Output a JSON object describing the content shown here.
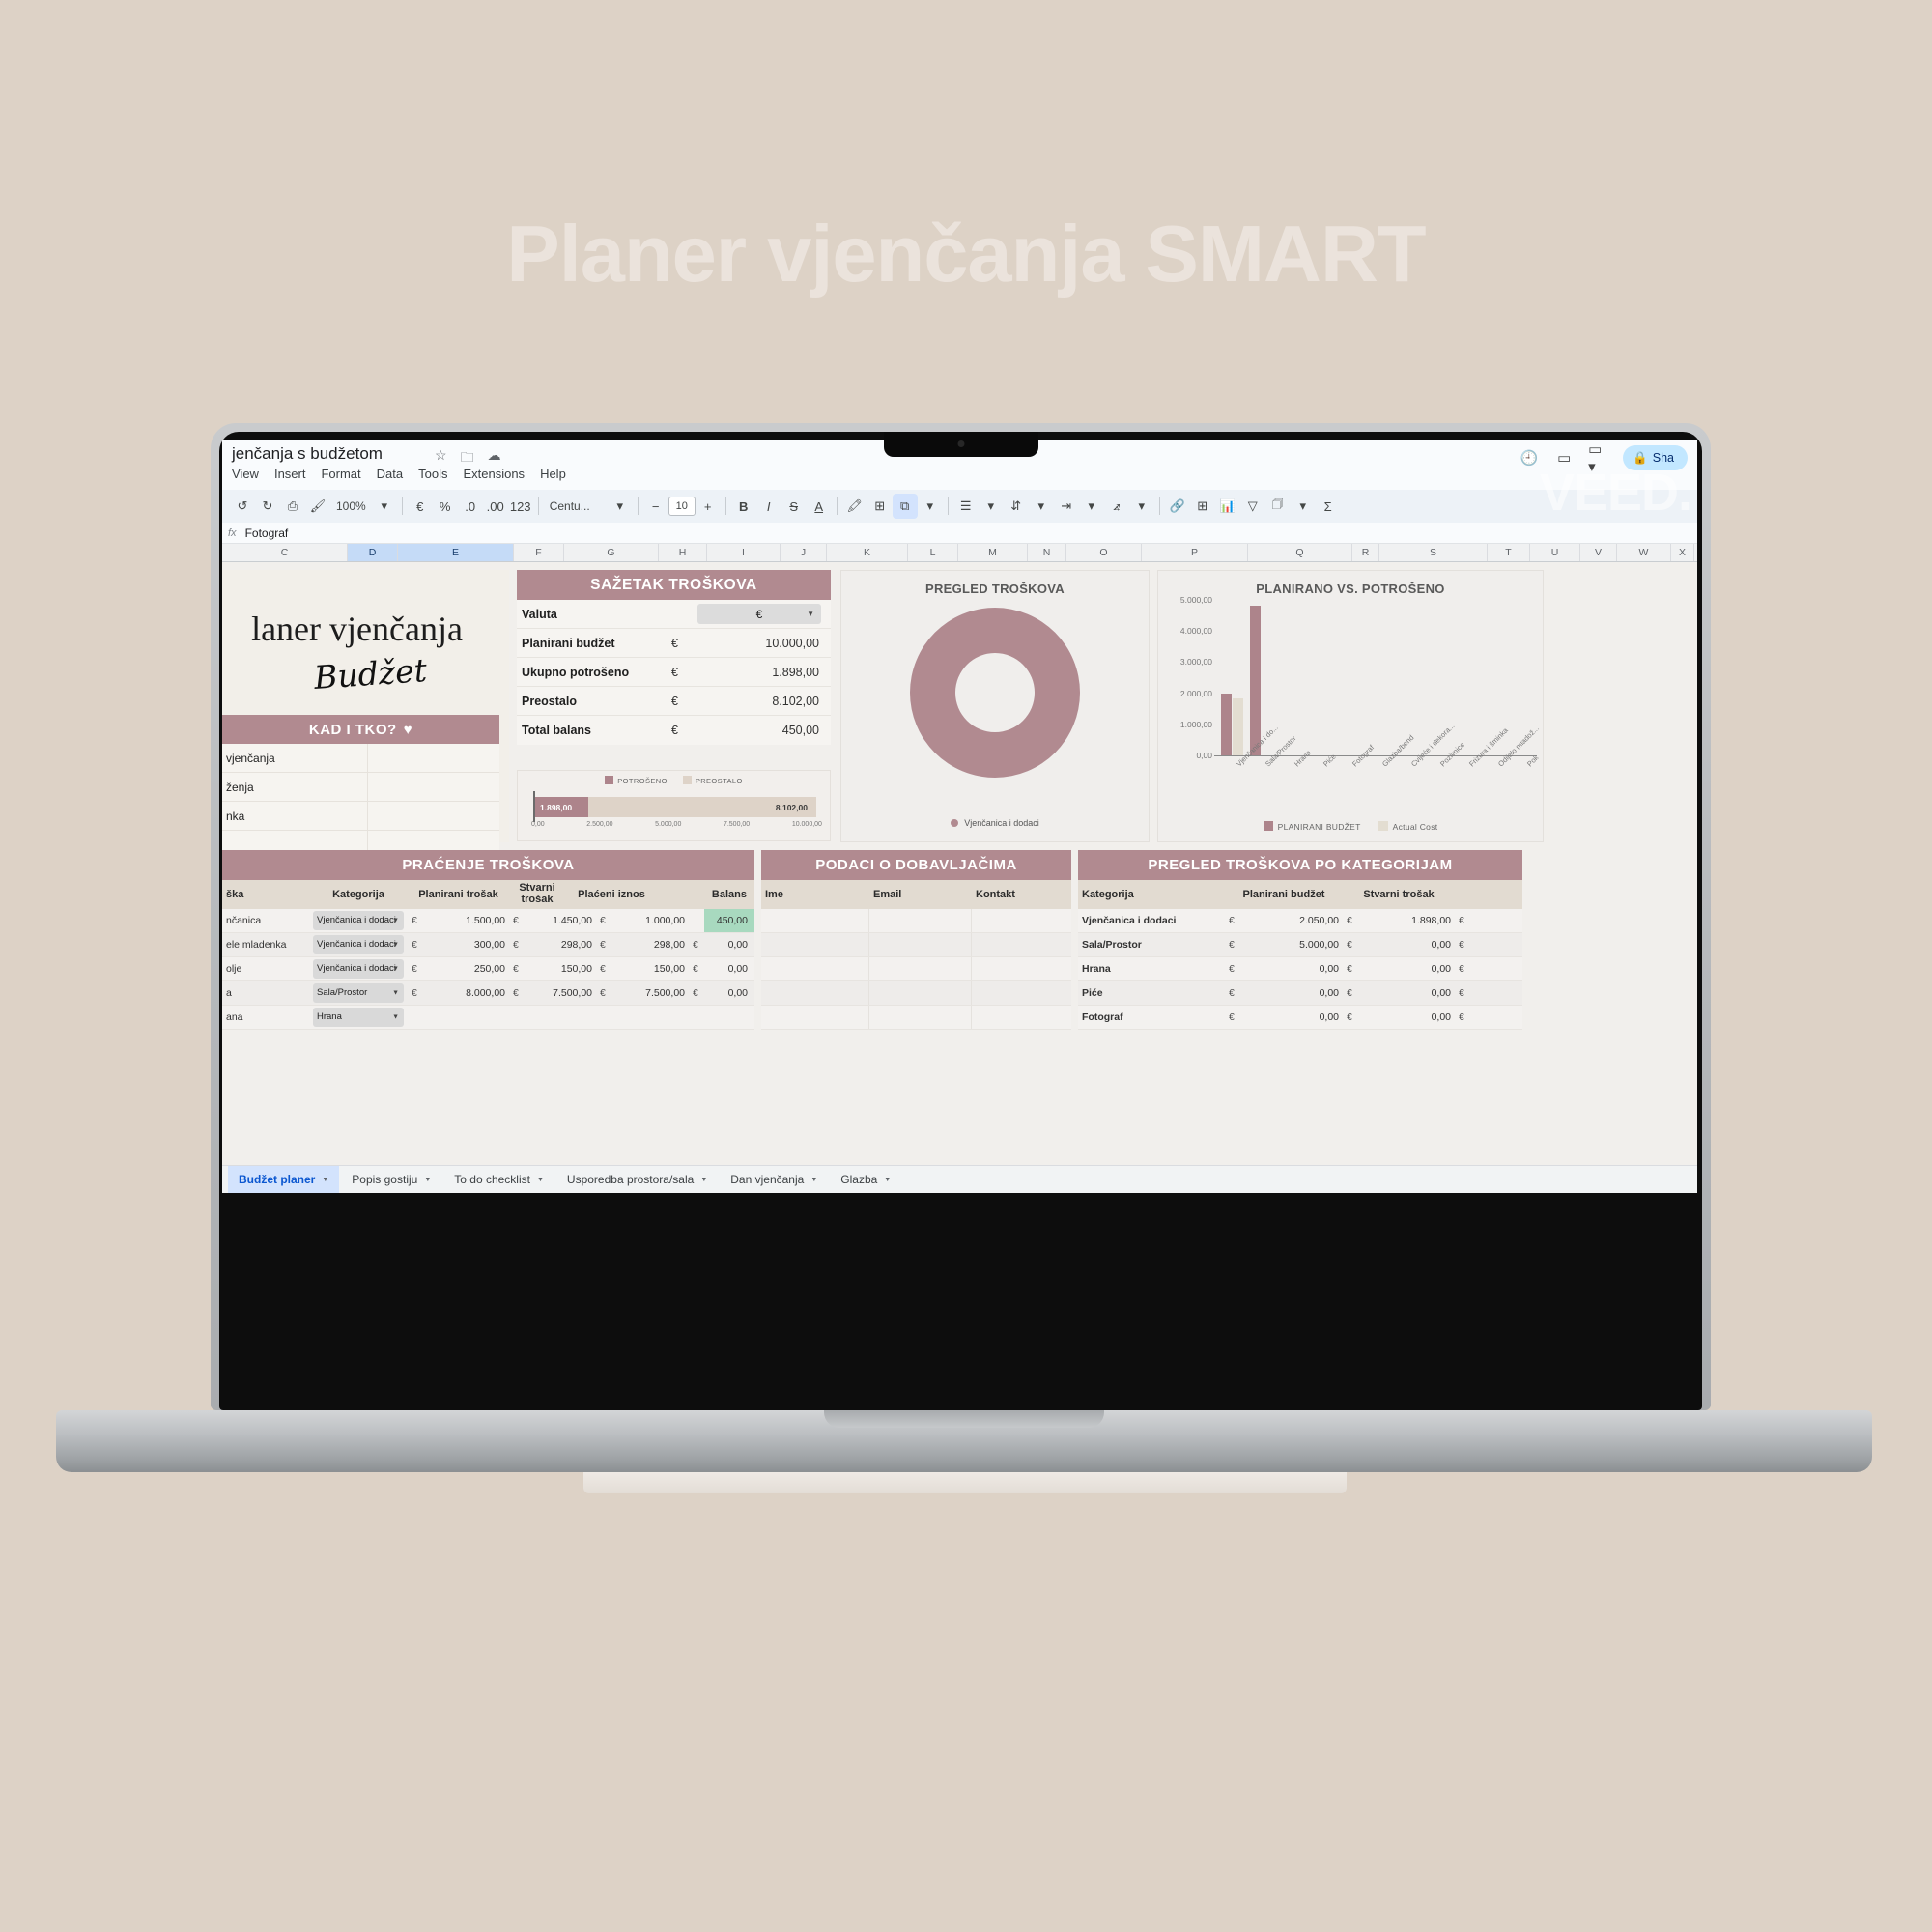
{
  "hero": {
    "title": "Planer vjenčanja SMART"
  },
  "watermark": {
    "text": "VEED."
  },
  "app": {
    "doc_title": "jenčanja s budžetom",
    "title_icons": [
      "star-icon",
      "move-to-folder-icon",
      "cloud-saved-icon"
    ],
    "menus": [
      "View",
      "Insert",
      "Format",
      "Data",
      "Tools",
      "Extensions",
      "Help"
    ],
    "share_label": "Sha",
    "toolbar": {
      "zoom": "100%",
      "currency_symbol": "€",
      "percent_symbol": "%",
      "decr_decimal": ".0",
      "incr_decimal": ".00",
      "more_formats": "123",
      "font_name": "Centu...",
      "font_size": "10",
      "bold": "B",
      "italic": "I",
      "strikethrough": "S",
      "text_color": "A",
      "minus": "−",
      "plus": "+"
    },
    "formula_bar": {
      "fx": "fx",
      "value": "Fotograf"
    },
    "columns": [
      "C",
      "D",
      "E",
      "F",
      "G",
      "H",
      "I",
      "J",
      "K",
      "L",
      "M",
      "N",
      "O",
      "P",
      "Q",
      "R",
      "S",
      "T",
      "U",
      "V",
      "W",
      "X"
    ],
    "selected_columns": [
      "D",
      "E"
    ],
    "sheet_tabs": [
      {
        "label": "Budžet planer",
        "active": true
      },
      {
        "label": "Popis gostiju",
        "active": false
      },
      {
        "label": "To do checklist",
        "active": false
      },
      {
        "label": "Usporedba prostora/sala",
        "active": false
      },
      {
        "label": "Dan vjenčanja",
        "active": false
      },
      {
        "label": "Glazba",
        "active": false
      }
    ]
  },
  "brand": {
    "title": "laner vjenčanja",
    "script": "Budžet"
  },
  "kad_i_tko": {
    "header": "KAD I TKO?",
    "heart": "♥",
    "rows": [
      {
        "label": "vjenčanja",
        "value": ""
      },
      {
        "label": "ženja",
        "value": ""
      },
      {
        "label": "nka",
        "value": ""
      },
      {
        "label": "",
        "value": ""
      }
    ]
  },
  "sazetak": {
    "header": "SAŽETAK TROŠKOVA",
    "rows": [
      {
        "key": "Valuta",
        "type": "dropdown",
        "currency": "",
        "value": "€"
      },
      {
        "key": "Planirani budžet",
        "type": "amount",
        "currency": "€",
        "value": "10.000,00"
      },
      {
        "key": "Ukupno potrošeno",
        "type": "amount",
        "currency": "€",
        "value": "1.898,00"
      },
      {
        "key": "Preostalo",
        "type": "amount",
        "currency": "€",
        "value": "8.102,00"
      },
      {
        "key": "Total balans",
        "type": "amount",
        "currency": "€",
        "value": "450,00"
      }
    ]
  },
  "chart_data": [
    {
      "id": "budget-progress-bar",
      "type": "bar",
      "orientation": "horizontal",
      "title": "",
      "categories": [
        "POTROŠENO",
        "PREOSTALO"
      ],
      "values": [
        1898.0,
        8102.0
      ],
      "labels": [
        "1.898,00",
        "8.102,00"
      ],
      "legend": [
        "POTROŠENO",
        "PREOSTALO"
      ],
      "legend_position": "top",
      "colors": [
        "#ad848b",
        "#ded3c8"
      ],
      "xlim": [
        0,
        10000
      ],
      "xticks": [
        "0,00",
        "2.500,00",
        "5.000,00",
        "7.500,00",
        "10.000,00"
      ],
      "grid": false
    },
    {
      "id": "pregled-troskova-donut",
      "type": "pie",
      "variant": "donut",
      "title": "PREGLED TROŠKOVA",
      "categories": [
        "Vjenčanica i dodaci"
      ],
      "values": [
        1898.0
      ],
      "legend": [
        "Vjenčanica i dodaci"
      ],
      "legend_position": "bottom",
      "colors": [
        "#b18a90"
      ]
    },
    {
      "id": "planirano-vs-potroseno-bar",
      "type": "bar",
      "title": "PLANIRANO VS. POTROŠENO",
      "categories": [
        "Vjenčanica i do...",
        "Sala/Prostor",
        "Hrana",
        "Piće",
        "Fotograf",
        "Glazba/bend",
        "Cvijeće i dekora...",
        "Pozivnice",
        "Frizura i šminka",
        "Odijelo mladož...",
        "Pok"
      ],
      "series": [
        {
          "name": "PLANIRANI BUDŽET",
          "color": "#ad848b",
          "values": [
            2050,
            5000,
            0,
            0,
            0,
            0,
            0,
            0,
            0,
            0,
            0
          ]
        },
        {
          "name": "Actual Cost",
          "color": "#e3ddd1",
          "values": [
            1898,
            0,
            0,
            0,
            0,
            0,
            0,
            0,
            0,
            0,
            0
          ]
        }
      ],
      "ylim": [
        0,
        5000
      ],
      "yticks": [
        "0,00",
        "1.000,00",
        "2.000,00",
        "3.000,00",
        "4.000,00",
        "5.000,00"
      ],
      "legend": [
        "PLANIRANI BUDŽET",
        "Actual Cost"
      ],
      "legend_position": "bottom",
      "xlabel": "",
      "ylabel": "",
      "grid": false
    }
  ],
  "pracenje": {
    "header": "PRAĆENJE TROŠKOVA",
    "columns": [
      "ška",
      "Kategorija",
      "Planirani trošak",
      "Stvarni trošak",
      "Plaćeni iznos",
      "Balans"
    ],
    "rows": [
      {
        "item": "nčanica",
        "category": "Vjenčanica i dodaci",
        "plan_cur": "€",
        "plan": "1.500,00",
        "actual_cur": "€",
        "actual": "1.450,00",
        "paid_cur": "€",
        "paid": "1.000,00",
        "balance_cur": "",
        "balance": "450,00",
        "balance_highlight": true
      },
      {
        "item": "ele mladenka",
        "category": "Vjenčanica i dodaci",
        "plan_cur": "€",
        "plan": "300,00",
        "actual_cur": "€",
        "actual": "298,00",
        "paid_cur": "€",
        "paid": "298,00",
        "balance_cur": "€",
        "balance": "0,00",
        "balance_highlight": false
      },
      {
        "item": "olje",
        "category": "Vjenčanica i dodaci",
        "plan_cur": "€",
        "plan": "250,00",
        "actual_cur": "€",
        "actual": "150,00",
        "paid_cur": "€",
        "paid": "150,00",
        "balance_cur": "€",
        "balance": "0,00",
        "balance_highlight": false
      },
      {
        "item": "a",
        "category": "Sala/Prostor",
        "plan_cur": "€",
        "plan": "8.000,00",
        "actual_cur": "€",
        "actual": "7.500,00",
        "paid_cur": "€",
        "paid": "7.500,00",
        "balance_cur": "€",
        "balance": "0,00",
        "balance_highlight": false
      },
      {
        "item": "ana",
        "category": "Hrana",
        "plan_cur": "",
        "plan": "",
        "actual_cur": "",
        "actual": "",
        "paid_cur": "",
        "paid": "",
        "balance_cur": "",
        "balance": "",
        "balance_highlight": false
      }
    ]
  },
  "dobavljaci": {
    "header": "PODACI O DOBAVLJAČIMA",
    "columns": [
      "Ime",
      "Email",
      "Kontakt"
    ],
    "rows": [
      {
        "ime": "",
        "email": "",
        "kontakt": ""
      },
      {
        "ime": "",
        "email": "",
        "kontakt": ""
      },
      {
        "ime": "",
        "email": "",
        "kontakt": ""
      },
      {
        "ime": "",
        "email": "",
        "kontakt": ""
      },
      {
        "ime": "",
        "email": "",
        "kontakt": ""
      }
    ]
  },
  "kategorije": {
    "header": "PREGLED TROŠKOVA PO KATEGORIJAM",
    "columns": [
      "Kategorija",
      "Planirani budžet",
      "Stvarni trošak",
      ""
    ],
    "rows": [
      {
        "kategorija": "Vjenčanica i dodaci",
        "plan_cur": "€",
        "plan": "2.050,00",
        "act_cur": "€",
        "act": "1.898,00",
        "last_cur": "€"
      },
      {
        "kategorija": "Sala/Prostor",
        "plan_cur": "€",
        "plan": "5.000,00",
        "act_cur": "€",
        "act": "0,00",
        "last_cur": "€"
      },
      {
        "kategorija": "Hrana",
        "plan_cur": "€",
        "plan": "0,00",
        "act_cur": "€",
        "act": "0,00",
        "last_cur": "€"
      },
      {
        "kategorija": "Piće",
        "plan_cur": "€",
        "plan": "0,00",
        "act_cur": "€",
        "act": "0,00",
        "last_cur": "€"
      },
      {
        "kategorija": "Fotograf",
        "plan_cur": "€",
        "plan": "0,00",
        "act_cur": "€",
        "act": "0,00",
        "last_cur": "€"
      }
    ]
  },
  "colors": {
    "accent_pink": "#b18a90",
    "bar_plan": "#ad848b",
    "bar_actual": "#e3ddd1",
    "table_header_beige": "#e2dbd1",
    "page_bg": "#ddd2c6",
    "green_highlight": "#a8d9bf",
    "share_bg": "#c2e7ff"
  }
}
